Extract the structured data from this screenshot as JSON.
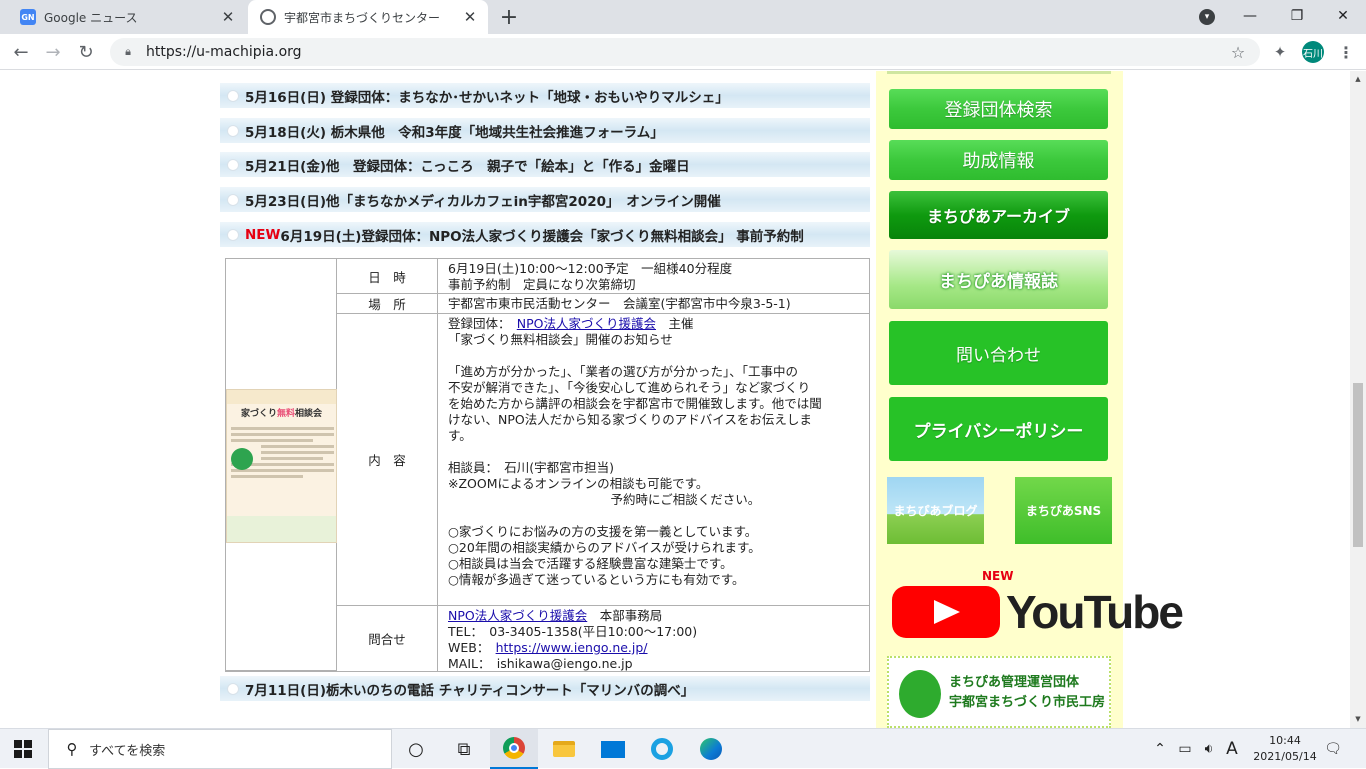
{
  "browser": {
    "tabs": [
      {
        "title": "Google ニュース",
        "favicon": "GN"
      },
      {
        "title": "宇都宮市まちづくりセンター"
      }
    ],
    "url": "https://u-machipia.org",
    "profile_label": "石川"
  },
  "news": [
    {
      "text": "5月16日(日) 登録団体：まちなか･せかいネット「地球・おもいやりマルシェ」"
    },
    {
      "text": "5月18日(火) 栃木県他　令和3年度「地域共生社会推進フォーラム」"
    },
    {
      "text": "5月21日(金)他　登録団体：こっころ　親子で「絵本」と「作る」金曜日"
    },
    {
      "text": "5月23日(日)他「まちなかメディカルカフェin宇都宮2020」　オンライン開催"
    },
    {
      "new": "NEW",
      "text": "6月19日(土)登録団体：NPO法人家づくり援護会「家づくり無料相談会」 事前予約制"
    },
    {
      "text": "7月11日(日)栃木いのちの電話 チャリティコンサート「マリンバの調べ」"
    }
  ],
  "detail": {
    "flyer": {
      "title_pre": "家づくり",
      "title_hl": "無料",
      "title_post": "相談会",
      "phone": "03-3405-1358"
    },
    "rows": {
      "date": {
        "label": "日　時",
        "line1": "6月19日(土)10:00～12:00予定　一組様40分程度",
        "line2": "事前予約制　定員になり次第締切"
      },
      "place": {
        "label": "場　所",
        "value": "宇都宮市東市民活動センター　会議室(宇都宮市中今泉3-5-1)"
      },
      "content": {
        "label": "内　容",
        "org_prefix": "登録団体：　",
        "org_link": "NPO法人家づくり援護会",
        "org_suffix": "　主催",
        "line2": "「家づくり無料相談会」開催のお知らせ",
        "para": "「進め方が分かった」、「業者の選び方が分かった」、「工事中の\n不安が解消できた」、「今後安心して進められそう」など家づくり\nを始めた方から講評の相談会を宇都宮市で開催致します。他では聞\nけない、NPO法人だから知る家づくりのアドバイスをお伝えしま\nす。",
        "consult": "相談員：　石川(宇都宮市担当)\n※ZOOMによるオンラインの相談も可能です。\n　　　　　　　　　　　　　予約時にご相談ください。",
        "points": "○家づくりにお悩みの方の支援を第一義としています。\n○20年間の相談実績からのアドバイスが受けられます。\n○相談員は当会で活躍する経験豊富な建築士です。\n○情報が多過ぎて迷っているという方にも有効です。"
      },
      "contact": {
        "label": "問合せ",
        "org_link": "NPO法人家づくり援護会",
        "org_suffix": "　本部事務局",
        "tel": "TEL：　03-3405-1358(平日10:00～17:00)",
        "web_prefix": "WEB：　",
        "web_link": "https://www.iengo.ne.jp/",
        "mail": "MAIL：　ishikawa@iengo.ne.jp"
      }
    }
  },
  "sidebar": {
    "buttons": [
      {
        "label": "登録団体検索"
      },
      {
        "label": "助成情報"
      },
      {
        "label": "まちぴあアーカイブ"
      },
      {
        "label": "まちぴあ情報誌"
      },
      {
        "label": "問い合わせ"
      },
      {
        "label": "プライバシーポリシー"
      }
    ],
    "banners": [
      {
        "label": "まちぴあブログ"
      },
      {
        "label": "まちぴあSNS"
      }
    ],
    "youtube": {
      "new": "NEW",
      "label": "YouTube"
    },
    "org": {
      "line1": "まちぴあ管理運営団体",
      "line2": "宇都宮まちづくり市民工房"
    }
  },
  "taskbar": {
    "search_placeholder": "すべてを検索",
    "ime": "A",
    "time": "10:44",
    "date": "2021/05/14"
  }
}
